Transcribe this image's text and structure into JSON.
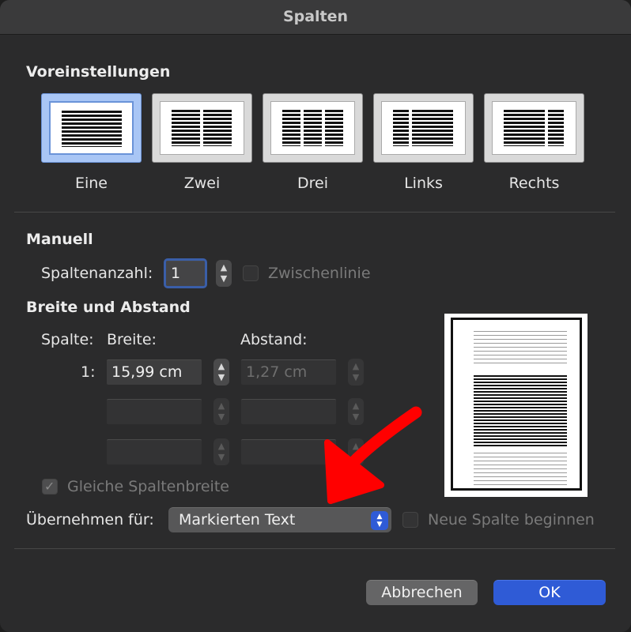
{
  "window": {
    "title": "Spalten"
  },
  "presets": {
    "heading": "Voreinstellungen",
    "items": [
      {
        "label": "Eine",
        "selected": true
      },
      {
        "label": "Zwei",
        "selected": false
      },
      {
        "label": "Drei",
        "selected": false
      },
      {
        "label": "Links",
        "selected": false
      },
      {
        "label": "Rechts",
        "selected": false
      }
    ]
  },
  "manual": {
    "heading": "Manuell",
    "column_count_label": "Spaltenanzahl:",
    "column_count_value": "1",
    "separator_label": "Zwischenlinie",
    "separator_checked": false
  },
  "width_spacing": {
    "heading": "Breite und Abstand",
    "col_header": "Spalte:",
    "width_header": "Breite:",
    "spacing_header": "Abstand:",
    "rows": [
      {
        "index": "1:",
        "width": "15,99 cm",
        "spacing": "1,27 cm"
      },
      {
        "index": "",
        "width": "",
        "spacing": ""
      },
      {
        "index": "",
        "width": "",
        "spacing": ""
      }
    ],
    "equal_width_label": "Gleiche Spaltenbreite",
    "equal_width_checked": true
  },
  "apply": {
    "label": "Übernehmen für:",
    "selected": "Markierten Text",
    "new_column_label": "Neue Spalte beginnen",
    "new_column_checked": false
  },
  "buttons": {
    "cancel": "Abbrechen",
    "ok": "OK"
  },
  "colors": {
    "accent": "#2f5bd6",
    "annotation": "#ff0000",
    "selection": "#a9c6f5"
  },
  "icons": {
    "stepper_up": "chevron-up-icon",
    "stepper_down": "chevron-down-icon",
    "popup": "up-down-chevron-icon",
    "check": "checkmark-icon"
  }
}
